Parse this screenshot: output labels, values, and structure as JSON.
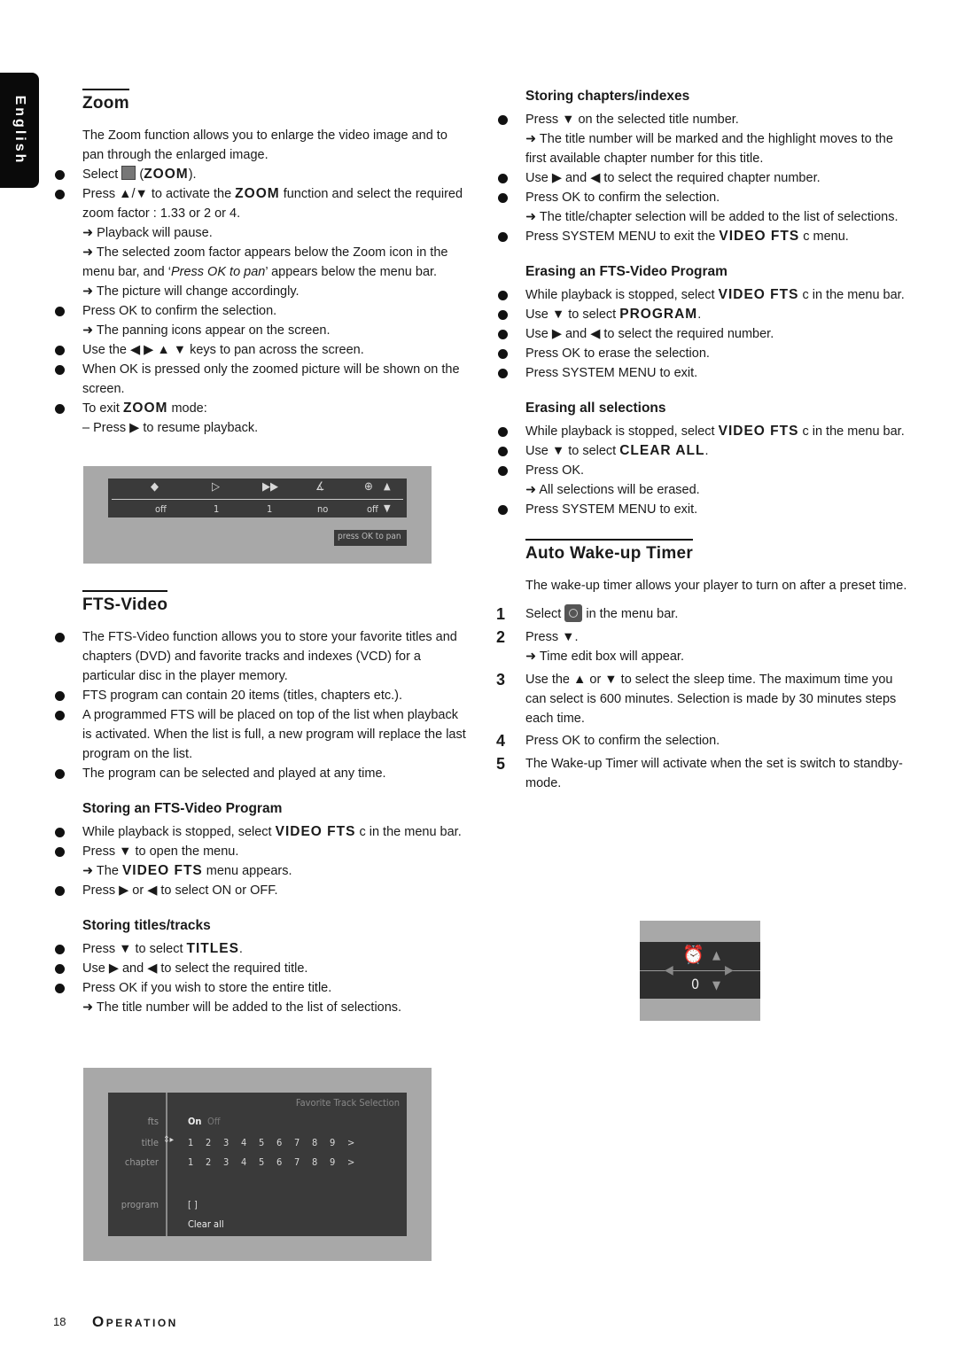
{
  "language_tab": "English",
  "zoom": {
    "heading": "Zoom",
    "intro": "The Zoom function allows you to enlarge the video image and to pan through the enlarged image.",
    "items": [
      {
        "pre": "Select ",
        "icon": "zoom-icon",
        "post_open": " (",
        "bold": "ZOOM",
        "post": ")."
      },
      {
        "pre": "Press ▲/▼ to activate the ",
        "bold": "ZOOM",
        "post": " function and select the required zoom factor : 1.33 or 2 or 4."
      },
      {
        "arrow1": "➜ Playback will pause."
      },
      {
        "arrow2_pre": "➜ The selected zoom factor appears below the Zoom icon in the menu bar, and ‘",
        "arrow2_italic": "Press OK to pan",
        "arrow2_post": "’ appears below the menu bar."
      },
      {
        "arrow3": "➜ The picture will change accordingly."
      }
    ],
    "b_confirm": "Press OK to confirm the selection.",
    "b_confirm_arrow": "➜ The panning icons appear on the screen.",
    "b_pan": "Use the ◀ ▶ ▲ ▼ keys to pan across the screen.",
    "b_ok": "When OK is pressed only the zoomed picture will be shown on the screen.",
    "b_exit_pre": "To exit ",
    "b_exit_bold": "ZOOM",
    "b_exit_post": " mode:",
    "b_exit_sub": "–  Press ▶ to resume playback.",
    "osd": {
      "values": [
        "off",
        "1",
        "1",
        "no",
        "off"
      ],
      "pan_label": "press OK to pan"
    }
  },
  "fts": {
    "heading": "FTS-Video",
    "bullets": [
      "The FTS-Video function allows you to store your favorite titles and chapters (DVD) and favorite tracks and indexes (VCD) for a particular disc in the player memory.",
      "FTS program can contain 20 items (titles, chapters etc.).",
      "A programmed FTS will be placed on top of the list when playback is activated. When the list is full, a new program will replace the last program on the list.",
      "The program can be selected and played at any time."
    ],
    "store": {
      "heading": "Storing an FTS-Video Program",
      "b1_pre": "While playback is stopped, select ",
      "b1_bold": "VIDEO FTS",
      "b1_post": " c   in the menu bar.",
      "b2": "Press ▼ to open the menu.",
      "b2_arrow_pre": "➜ The ",
      "b2_arrow_bold": "VIDEO FTS",
      "b2_arrow_post": " menu appears.",
      "b3": "Press ▶ or ◀  to select ON or OFF."
    },
    "titles": {
      "heading": "Storing titles/tracks",
      "b1_pre": "Press ▼ to select ",
      "b1_bold": "TITLES",
      "b1_post": ".",
      "b2": "Use ▶ and ◀ to select the required title.",
      "b3": "Press OK if you wish to store the entire title.",
      "b3_arrow": "➜ The title number will be added to the list of selections."
    },
    "osd": {
      "title": "Favorite Track Selection",
      "rows": [
        "fts",
        "title",
        "chapter",
        "program"
      ],
      "on": "On",
      "off": "Off",
      "numbers": [
        "1",
        "2",
        "3",
        "4",
        "5",
        "6",
        "7",
        "8",
        "9",
        ">"
      ],
      "program_value": "[ ]",
      "clear_all": "Clear all"
    }
  },
  "chapters": {
    "heading": "Storing chapters/indexes",
    "b1": "Press ▼ on the selected title number.",
    "b1_arrow": "➜ The title number will be marked and the highlight moves to the first available chapter number for this title.",
    "b2": "Use ▶ and ◀ to select the required chapter number.",
    "b3": "Press OK to confirm the selection.",
    "b3_arrow": "➜ The title/chapter selection will be added to the list of selections.",
    "b4_pre": "Press SYSTEM MENU to exit the ",
    "b4_bold": "VIDEO FTS",
    "b4_post": " c   menu."
  },
  "erase_program": {
    "heading": "Erasing an FTS-Video Program",
    "b1_pre": "While playback is stopped, select ",
    "b1_bold": "VIDEO FTS",
    "b1_post": " c   in the menu bar.",
    "b2_pre": "Use ▼ to select ",
    "b2_bold": "PROGRAM",
    "b2_post": ".",
    "b3": "Use ▶ and ◀ to select the required number.",
    "b4": "Press OK to erase the selection.",
    "b5": "Press SYSTEM MENU to exit."
  },
  "erase_all": {
    "heading": "Erasing all selections",
    "b1_pre": "While playback is stopped, select ",
    "b1_bold": "VIDEO FTS",
    "b1_post": " c   in the menu bar.",
    "b2_pre": "Use ▼ to select ",
    "b2_bold": "CLEAR ALL",
    "b2_post": ".",
    "b3": "Press OK.",
    "b3_arrow": "➜ All selections will be erased.",
    "b4": "Press SYSTEM MENU to exit."
  },
  "wakeup": {
    "heading": "Auto Wake-up Timer",
    "intro": "The wake-up timer allows your player to turn on after a preset time.",
    "steps": [
      {
        "n": "1",
        "pre": "Select ",
        "post": " in the menu bar."
      },
      {
        "n": "2",
        "text": "Press ▼.",
        "arrow": "➜ Time edit box will appear."
      },
      {
        "n": "3",
        "text": "Use the ▲ or ▼ to select the sleep time. The maximum time you can select is 600 minutes. Selection is made by 30 minutes steps each time."
      },
      {
        "n": "4",
        "text": "Press OK to confirm the selection."
      },
      {
        "n": "5",
        "text": "The Wake-up Timer will activate when the set is switch to standby-mode."
      }
    ],
    "osd_value": "0"
  },
  "footer": {
    "page_number": "18",
    "section_first": "O",
    "section_rest": "PERATION"
  }
}
